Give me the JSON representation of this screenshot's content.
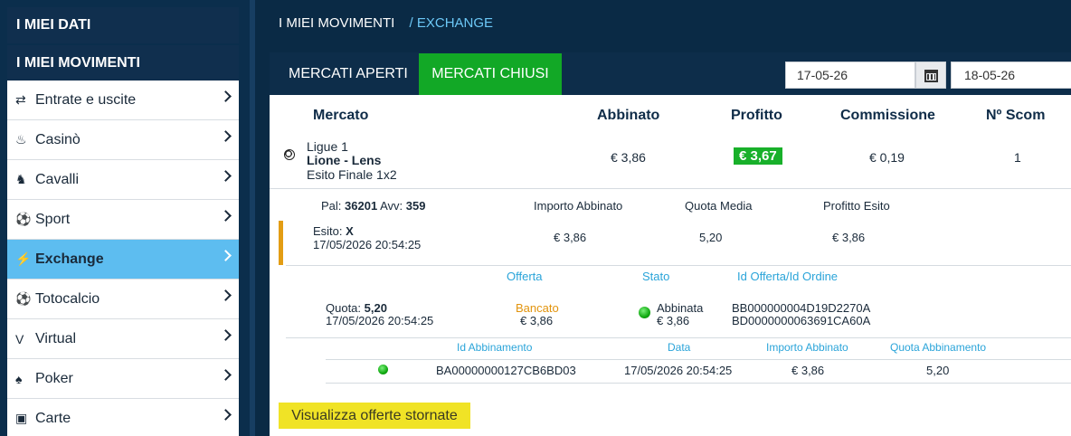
{
  "sidebar": {
    "section1": "I MIEI DATI",
    "section2": "I MIEI MOVIMENTI",
    "items": [
      {
        "label": "Entrate e uscite",
        "icon": "transfer-arrows-icon",
        "glyph": "⇄"
      },
      {
        "label": "Casinò",
        "icon": "casino-icon",
        "glyph": "♨"
      },
      {
        "label": "Cavalli",
        "icon": "horse-icon",
        "glyph": "♞"
      },
      {
        "label": "Sport",
        "icon": "soccer-ball-icon",
        "glyph": "⚽"
      },
      {
        "label": "Exchange",
        "icon": "exchange-icon",
        "glyph": "⚡"
      },
      {
        "label": "Totocalcio",
        "icon": "soccer-ball-icon",
        "glyph": "⚽"
      },
      {
        "label": "Virtual",
        "icon": "virtual-icon",
        "glyph": "V"
      },
      {
        "label": "Poker",
        "icon": "spade-icon",
        "glyph": "♠"
      },
      {
        "label": "Carte",
        "icon": "card-icon",
        "glyph": "▣"
      }
    ],
    "active_index": 4
  },
  "breadcrumb": {
    "root": "I MIEI MOVIMENTI",
    "current": "/ EXCHANGE"
  },
  "tabs": {
    "open": "MERCATI APERTI",
    "closed": "MERCATI CHIUSI"
  },
  "dates": {
    "from": "17-05-26",
    "to": "18-05-26"
  },
  "table": {
    "headers": {
      "market": "Mercato",
      "matched": "Abbinato",
      "profit": "Profitto",
      "commission": "Commissione",
      "num": "Nº Scom"
    },
    "row": {
      "league": "Ligue 1",
      "event": "Lione - Lens",
      "market_type": "Esito Finale 1x2",
      "matched": "€ 3,86",
      "profit": "€ 3,67",
      "commission": "€ 0,19",
      "count": "1"
    }
  },
  "detail": {
    "pal_label": "Pal:",
    "pal_value": "36201",
    "avv_label": "Avv:",
    "avv_value": "359",
    "col_headers": {
      "amount": "Importo Abbinato",
      "avg_odds": "Quota Media",
      "profit": "Profitto Esito"
    },
    "esito_label": "Esito:",
    "esito_value": "X",
    "esito_datetime": "17/05/2026 20:54:25",
    "amount": "€ 3,86",
    "avg_odds": "5,20",
    "profit": "€ 3,86"
  },
  "offer": {
    "headers": {
      "offer": "Offerta",
      "status": "Stato",
      "id": "Id Offerta/Id Ordine"
    },
    "quota_label": "Quota:",
    "quota_value": "5,20",
    "datetime": "17/05/2026 20:54:25",
    "type": "Bancato",
    "type_amount": "€ 3,86",
    "status": "Abbinata",
    "status_amount": "€ 3,86",
    "id_offer": "BB000000004D19D2270A",
    "id_order": "BD0000000063691CA60A"
  },
  "match": {
    "headers": {
      "id": "Id Abbinamento",
      "date": "Data",
      "amount": "Importo Abbinato",
      "quota": "Quota Abbinamento"
    },
    "id": "BA00000000127CB6BD03",
    "date": "17/05/2026 20:54:25",
    "amount": "€ 3,86",
    "quota": "5,20"
  },
  "button": {
    "show_cancelled": "Visualizza offerte stornate"
  },
  "colors": {
    "accent_green": "#12a826",
    "active_blue": "#5dbdf0",
    "header_navy": "#0a2a45",
    "highlight_yellow": "#f0e326"
  }
}
